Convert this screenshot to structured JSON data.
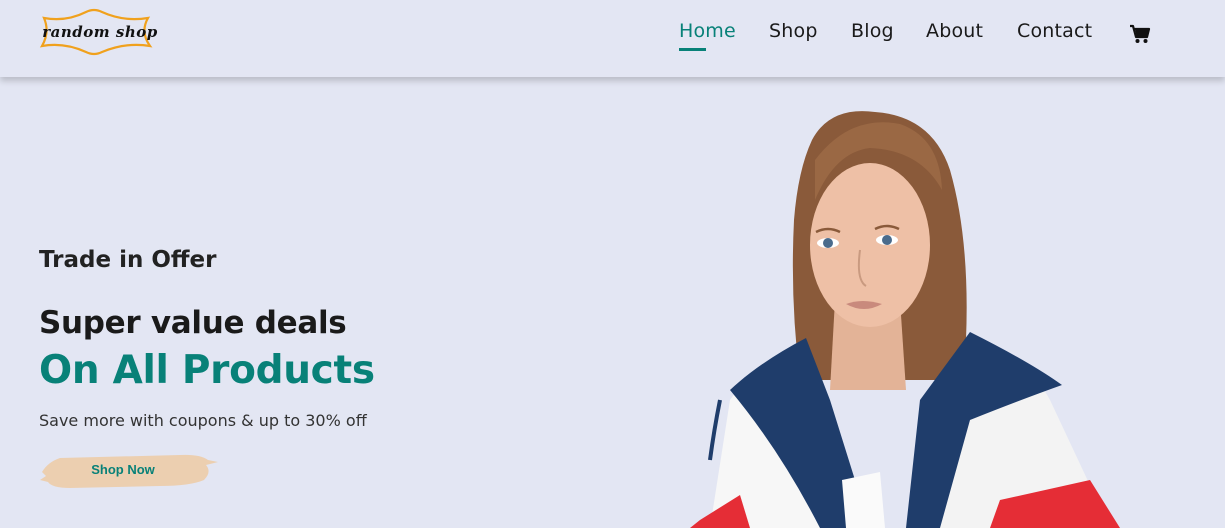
{
  "brand": {
    "logo_text": "random shop"
  },
  "nav": {
    "items": [
      {
        "label": "Home",
        "active": true
      },
      {
        "label": "Shop",
        "active": false
      },
      {
        "label": "Blog",
        "active": false
      },
      {
        "label": "About",
        "active": false
      },
      {
        "label": "Contact",
        "active": false
      }
    ],
    "cart_icon": "cart-icon"
  },
  "hero": {
    "eyebrow": "Trade in Offer",
    "headline": "Super value deals",
    "highlight": "On All Products",
    "description": "Save more with coupons & up to 30% off",
    "cta_label": "Shop Now",
    "image": "model-photo"
  },
  "colors": {
    "accent": "#088178",
    "background": "#e3e6f3",
    "logo_ribbon": "#f0a11d",
    "button_bg": "#eccfb0"
  }
}
